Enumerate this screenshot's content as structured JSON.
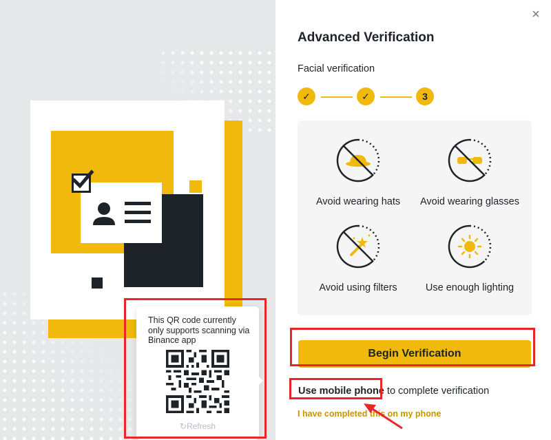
{
  "dialog": {
    "title": "Advanced Verification",
    "subtitle": "Facial verification",
    "close_symbol": "×",
    "steps": [
      {
        "state": "done",
        "symbol": "✓"
      },
      {
        "state": "done",
        "symbol": "✓"
      },
      {
        "state": "current",
        "label": "3"
      }
    ],
    "tips": [
      {
        "icon": "no-hat-icon",
        "label": "Avoid wearing hats"
      },
      {
        "icon": "no-glasses-icon",
        "label": "Avoid wearing glasses"
      },
      {
        "icon": "no-filter-icon",
        "label": "Avoid using filters"
      },
      {
        "icon": "lighting-icon",
        "label": "Use enough lighting"
      }
    ],
    "begin_button": "Begin Verification",
    "mobile_link": "Use mobile phone",
    "mobile_suffix": " to complete verification",
    "completed_link": "I have completed this on my phone"
  },
  "qr_popup": {
    "note": "This QR code currently only supports scanning via Binance app",
    "refresh_icon": "refresh-icon",
    "refresh_label": "Refresh"
  },
  "colors": {
    "brand_yellow": "#f0b90b",
    "dark": "#1e2329",
    "link_gold": "#c99400",
    "annotation_red": "#e8262a",
    "panel_gray": "#f5f5f5"
  }
}
